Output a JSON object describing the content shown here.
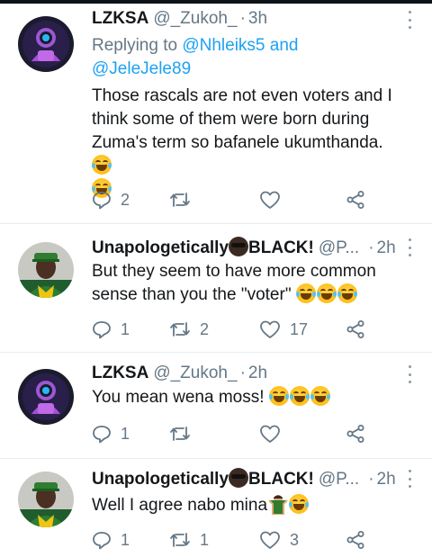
{
  "tweets": [
    {
      "name": "LZKSA",
      "handle": "@_Zukoh_",
      "time": "3h",
      "replying_label": "Replying to",
      "replying_to": [
        "@Nhleiks5",
        "@JeleJele89"
      ],
      "replying_joiner": "and",
      "text": "Those rascals are not even voters and I think some of them were born during Zuma's term so bafanele ukumthanda.",
      "emoji": "face-with-tears-of-joy",
      "reply_count": "2",
      "retweet_count": "",
      "like_count": ""
    },
    {
      "name_part1": "Unapologetically",
      "name_part2": "BLACK!",
      "handle": "@P...",
      "time": "2h",
      "text": "But they seem to have more common sense than you the \"voter\"",
      "emoji": "face-with-tears-of-joy",
      "reply_count": "1",
      "retweet_count": "2",
      "like_count": "17"
    },
    {
      "name": "LZKSA",
      "handle": "@_Zukoh_",
      "time": "2h",
      "text": "You mean wena moss!",
      "emoji": "face-with-tears-of-joy",
      "reply_count": "1",
      "retweet_count": "",
      "like_count": ""
    },
    {
      "name_part1": "Unapologetically",
      "name_part2": "BLACK!",
      "handle": "@P...",
      "time": "2h",
      "text": "Well I agree nabo mina",
      "emoji": "man-shrugging, face-with-tears-of-joy",
      "reply_count": "1",
      "retweet_count": "1",
      "like_count": "3"
    }
  ],
  "separator": "·",
  "colors": {
    "link": "#1da1f2",
    "secondary": "#657786",
    "text": "#14171a"
  },
  "icons": [
    "reply-icon",
    "retweet-icon",
    "like-icon",
    "share-icon",
    "more-icon"
  ]
}
